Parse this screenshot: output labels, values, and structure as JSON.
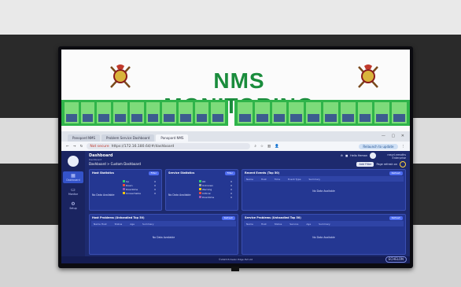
{
  "banner": {
    "title": "NMS MONITORING",
    "title_color": "#1a8c3c",
    "rack_color": "#2fb44a"
  },
  "browser": {
    "tabs": [
      {
        "label": "Panopard NMS",
        "active": false
      },
      {
        "label": "Problem Service Dashboard",
        "active": false
      },
      {
        "label": "Panopard NMS",
        "active": true
      }
    ],
    "window_controls": "— ▢ ✕",
    "not_secure": "Not secure",
    "url": "https://172.16.180.64/#/dashboard",
    "relaunch": "Relaunch to update"
  },
  "sidebar": {
    "items": [
      {
        "label": "Dashboard",
        "icon": "grid-icon",
        "active": true
      },
      {
        "label": "Monitor",
        "icon": "monitor-icon",
        "active": false
      },
      {
        "label": "Setup",
        "icon": "gear-icon",
        "active": false
      }
    ]
  },
  "header": {
    "title": "Dashboard",
    "breadcrumb": "Dashboard",
    "custom_label": "Dashboard > Custom Dashboard",
    "user_line1": "rasyd.nmsdhs",
    "user_line2": "Enterprise",
    "user_menu": "Hello Heman",
    "add_btn": "Add Filter",
    "page_refresh": "Page refresh on"
  },
  "panels": {
    "host_stats": {
      "title": "Host Statistics",
      "button": "Filter",
      "no_data": "No Data Available",
      "legend": [
        {
          "label": "Up",
          "value": "0",
          "color": "#2ecc71"
        },
        {
          "label": "Down",
          "value": "0",
          "color": "#e74c3c"
        },
        {
          "label": "Downtime",
          "value": "0",
          "color": "#9b59b6"
        },
        {
          "label": "Unreachable",
          "value": "0",
          "color": "#f1c40f"
        }
      ]
    },
    "service_stats": {
      "title": "Service Statistics",
      "button": "Filter",
      "no_data": "No Data Available",
      "legend": [
        {
          "label": "OK",
          "value": "0",
          "color": "#2ecc71"
        },
        {
          "label": "Unknown",
          "value": "0",
          "color": "#95a5a6"
        },
        {
          "label": "Warning",
          "value": "0",
          "color": "#f1c40f"
        },
        {
          "label": "Critical",
          "value": "0",
          "color": "#e74c3c"
        },
        {
          "label": "Downtime",
          "value": "0",
          "color": "#9b59b6"
        }
      ]
    },
    "recent_events": {
      "title": "Recent Events (Top 50)",
      "button": "Refresh",
      "columns": [
        "Name",
        "Host",
        "Time",
        "Event Type",
        "Summary"
      ],
      "no_data": "No Data Available"
    },
    "host_problems": {
      "title": "Host Problems (Unhandled Top 50)",
      "button": "Refresh",
      "columns": [
        "Name Host",
        "Status",
        "Age",
        "Summary"
      ],
      "no_data": "No Data Available"
    },
    "service_problems": {
      "title": "Service Problems (Unhandled Top 50)",
      "button": "Refresh",
      "columns": [
        "Name",
        "Host",
        "Status",
        "Service",
        "Age",
        "Summary"
      ],
      "no_data": "No Data Available"
    }
  },
  "footer": {
    "text": "©2023 Echelon Edge Pvt Ltd",
    "brand": "ECHELON"
  }
}
